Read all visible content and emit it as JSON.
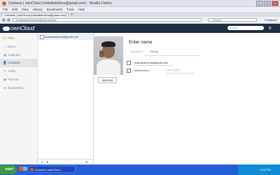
{
  "window": {
    "title": "Contacts | ownCloud (rickbabdrishna@gmail.com) - Mozilla Firefox",
    "buttons": [
      "_",
      "□",
      "X"
    ]
  },
  "menubar": [
    "File",
    "Edit",
    "View",
    "History",
    "Bookmarks",
    "Tools",
    "Help"
  ],
  "tab": {
    "label": "Contacts | ownCloud (rickbabdrishna@gmail.com)",
    "new_tab": "+"
  },
  "navbar": {
    "url": "localhost/owncloud/apps/contacts/",
    "search_placeholder": "Google",
    "feedback": "Feedback"
  },
  "header": {
    "logo": "ownCloud",
    "search_placeholder": "Search",
    "gear": "⚙"
  },
  "sidebar": {
    "items": [
      {
        "label": "Files",
        "icon": "📁"
      },
      {
        "label": "Music",
        "icon": "♫"
      },
      {
        "label": "Calendar",
        "icon": "▦"
      },
      {
        "label": "Contacts",
        "icon": "👤"
      },
      {
        "label": "Tasks",
        "icon": "☑"
      },
      {
        "label": "Pictures",
        "icon": "▣"
      },
      {
        "label": "Bookmarks",
        "icon": "★"
      }
    ]
  },
  "contacts_list": {
    "contacts": [
      "rickbabdrishna@gmail.com"
    ],
    "bottom_icons": [
      "+",
      "⬇",
      "⚙"
    ]
  },
  "detail": {
    "name": "Enter name",
    "middle_label": "Nickname",
    "middle_value": "Rocky",
    "email": "rickbabdrishna@gmail.com",
    "phone": "0812xxxxxx",
    "type_hint": "Select type",
    "add_field": "Add field"
  },
  "taskbar": {
    "start": "start",
    "task": "Contacts | ownCloud ...",
    "time": "5:52 PM"
  }
}
